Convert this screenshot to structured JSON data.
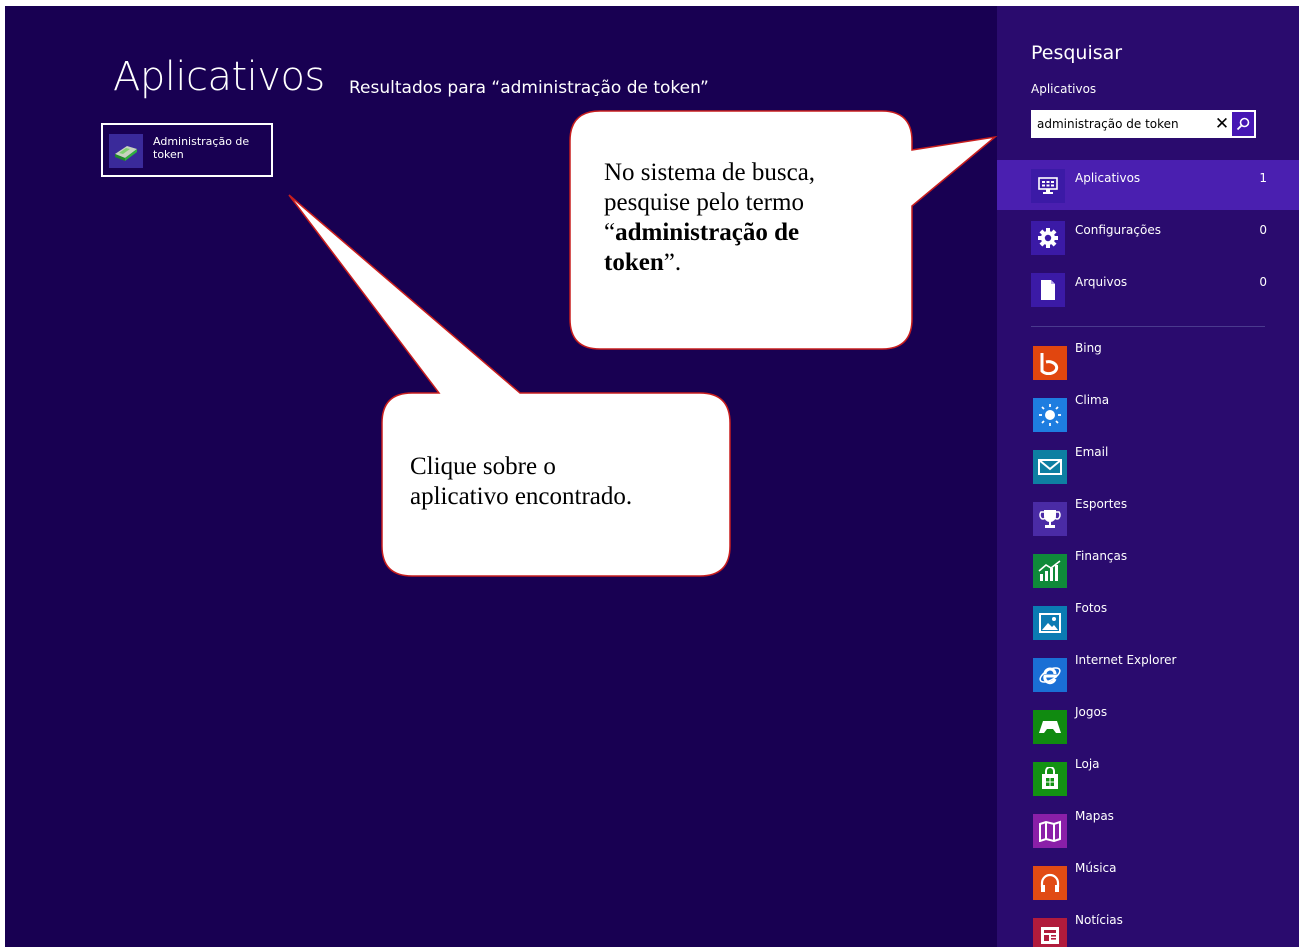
{
  "main": {
    "title": "Aplicativos",
    "results_label": "Resultados para “administração de token”",
    "result_tile": {
      "label": "Administração de token",
      "icon": "token-admin-icon"
    }
  },
  "search_pane": {
    "title": "Pesquisar",
    "scope": "Aplicativos",
    "query": "administração de token",
    "clear_icon": "close-icon",
    "search_icon": "search-icon",
    "categories": [
      {
        "label": "Aplicativos",
        "count": "1",
        "icon": "apps-icon",
        "selected": true
      },
      {
        "label": "Configurações",
        "count": "0",
        "icon": "gear-icon",
        "selected": false
      },
      {
        "label": "Arquivos",
        "count": "0",
        "icon": "file-icon",
        "selected": false
      }
    ],
    "apps": [
      {
        "label": "Bing",
        "icon": "bing-icon",
        "color": "#e1460f"
      },
      {
        "label": "Clima",
        "icon": "weather-icon",
        "color": "#1e7de0"
      },
      {
        "label": "Email",
        "icon": "mail-icon",
        "color": "#0e7fa2"
      },
      {
        "label": "Esportes",
        "icon": "trophy-icon",
        "color": "#4a2ba5"
      },
      {
        "label": "Finanças",
        "icon": "finance-icon",
        "color": "#0f8a3a"
      },
      {
        "label": "Fotos",
        "icon": "photos-icon",
        "color": "#0b7bb3"
      },
      {
        "label": "Internet Explorer",
        "icon": "ie-icon",
        "color": "#1a6fd5"
      },
      {
        "label": "Jogos",
        "icon": "games-icon",
        "color": "#108a10"
      },
      {
        "label": "Loja",
        "icon": "store-icon",
        "color": "#139213"
      },
      {
        "label": "Mapas",
        "icon": "maps-icon",
        "color": "#8a1fa8"
      },
      {
        "label": "Música",
        "icon": "music-icon",
        "color": "#e14b14"
      },
      {
        "label": "Notícias",
        "icon": "news-icon",
        "color": "#b11b3c"
      }
    ]
  },
  "callouts": {
    "search_tip": {
      "line1": "No sistema de busca,",
      "line2": "pesquise pelo termo",
      "open_quote": "“",
      "bold_term_1": "administração de",
      "bold_term_2": "token",
      "close_quote": "”."
    },
    "click_tip": {
      "line1": "Clique sobre o",
      "line2": "aplicativo encontrado."
    }
  }
}
